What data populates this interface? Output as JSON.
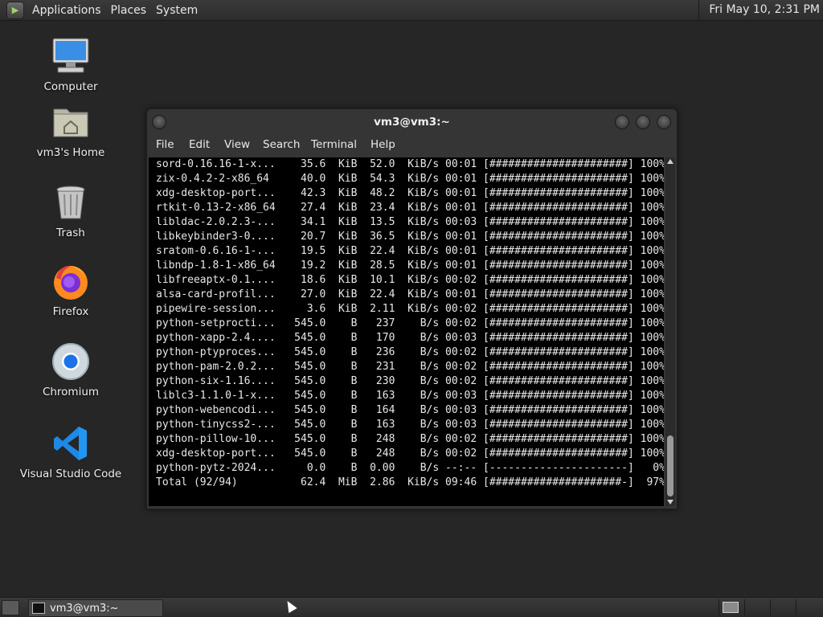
{
  "top_panel": {
    "menus": [
      "Applications",
      "Places",
      "System"
    ],
    "clock": "Fri May 10,  2:31 PM"
  },
  "desktop": {
    "icons": [
      {
        "label": "Computer",
        "icon": "computer-icon"
      },
      {
        "label": "vm3's Home",
        "icon": "home-folder-icon"
      },
      {
        "label": "Trash",
        "icon": "trash-icon"
      },
      {
        "label": "Firefox",
        "icon": "firefox-icon"
      },
      {
        "label": "Chromium",
        "icon": "chromium-icon"
      },
      {
        "label": "Visual Studio Code",
        "icon": "vscode-icon"
      }
    ]
  },
  "window": {
    "title": "vm3@vm3:~",
    "menu": [
      "File",
      "Edit",
      "View",
      "Search",
      "Terminal",
      "Help"
    ],
    "lines": [
      "sord-0.16.16-1-x...    35.6  KiB  52.0  KiB/s 00:01 [######################] 100%",
      "zix-0.4.2-2-x86_64     40.0  KiB  54.3  KiB/s 00:01 [######################] 100%",
      "xdg-desktop-port...    42.3  KiB  48.2  KiB/s 00:01 [######################] 100%",
      "rtkit-0.13-2-x86_64    27.4  KiB  23.4  KiB/s 00:01 [######################] 100%",
      "libldac-2.0.2.3-...    34.1  KiB  13.5  KiB/s 00:03 [######################] 100%",
      "libkeybinder3-0....    20.7  KiB  36.5  KiB/s 00:01 [######################] 100%",
      "sratom-0.6.16-1-...    19.5  KiB  22.4  KiB/s 00:01 [######################] 100%",
      "libndp-1.8-1-x86_64    19.2  KiB  28.5  KiB/s 00:01 [######################] 100%",
      "libfreeaptx-0.1....    18.6  KiB  10.1  KiB/s 00:02 [######################] 100%",
      "alsa-card-profil...    27.0  KiB  22.4  KiB/s 00:01 [######################] 100%",
      "pipewire-session...     3.6  KiB  2.11  KiB/s 00:02 [######################] 100%",
      "python-setprocti...   545.0    B   237    B/s 00:02 [######################] 100%",
      "python-xapp-2.4....   545.0    B   170    B/s 00:03 [######################] 100%",
      "python-ptyproces...   545.0    B   236    B/s 00:02 [######################] 100%",
      "python-pam-2.0.2...   545.0    B   231    B/s 00:02 [######################] 100%",
      "python-six-1.16....   545.0    B   230    B/s 00:02 [######################] 100%",
      "liblc3-1.1.0-1-x...   545.0    B   163    B/s 00:03 [######################] 100%",
      "python-webencodi...   545.0    B   164    B/s 00:03 [######################] 100%",
      "python-tinycss2-...   545.0    B   163    B/s 00:03 [######################] 100%",
      "python-pillow-10...   545.0    B   248    B/s 00:02 [######################] 100%",
      "xdg-desktop-port...   545.0    B   248    B/s 00:02 [######################] 100%",
      "python-pytz-2024...     0.0    B  0.00    B/s --:-- [----------------------]   0%",
      "Total (92/94)          62.4  MiB  2.86  KiB/s 09:46 [#####################-]  97%"
    ]
  },
  "taskbar": {
    "task_label": "vm3@vm3:~"
  }
}
